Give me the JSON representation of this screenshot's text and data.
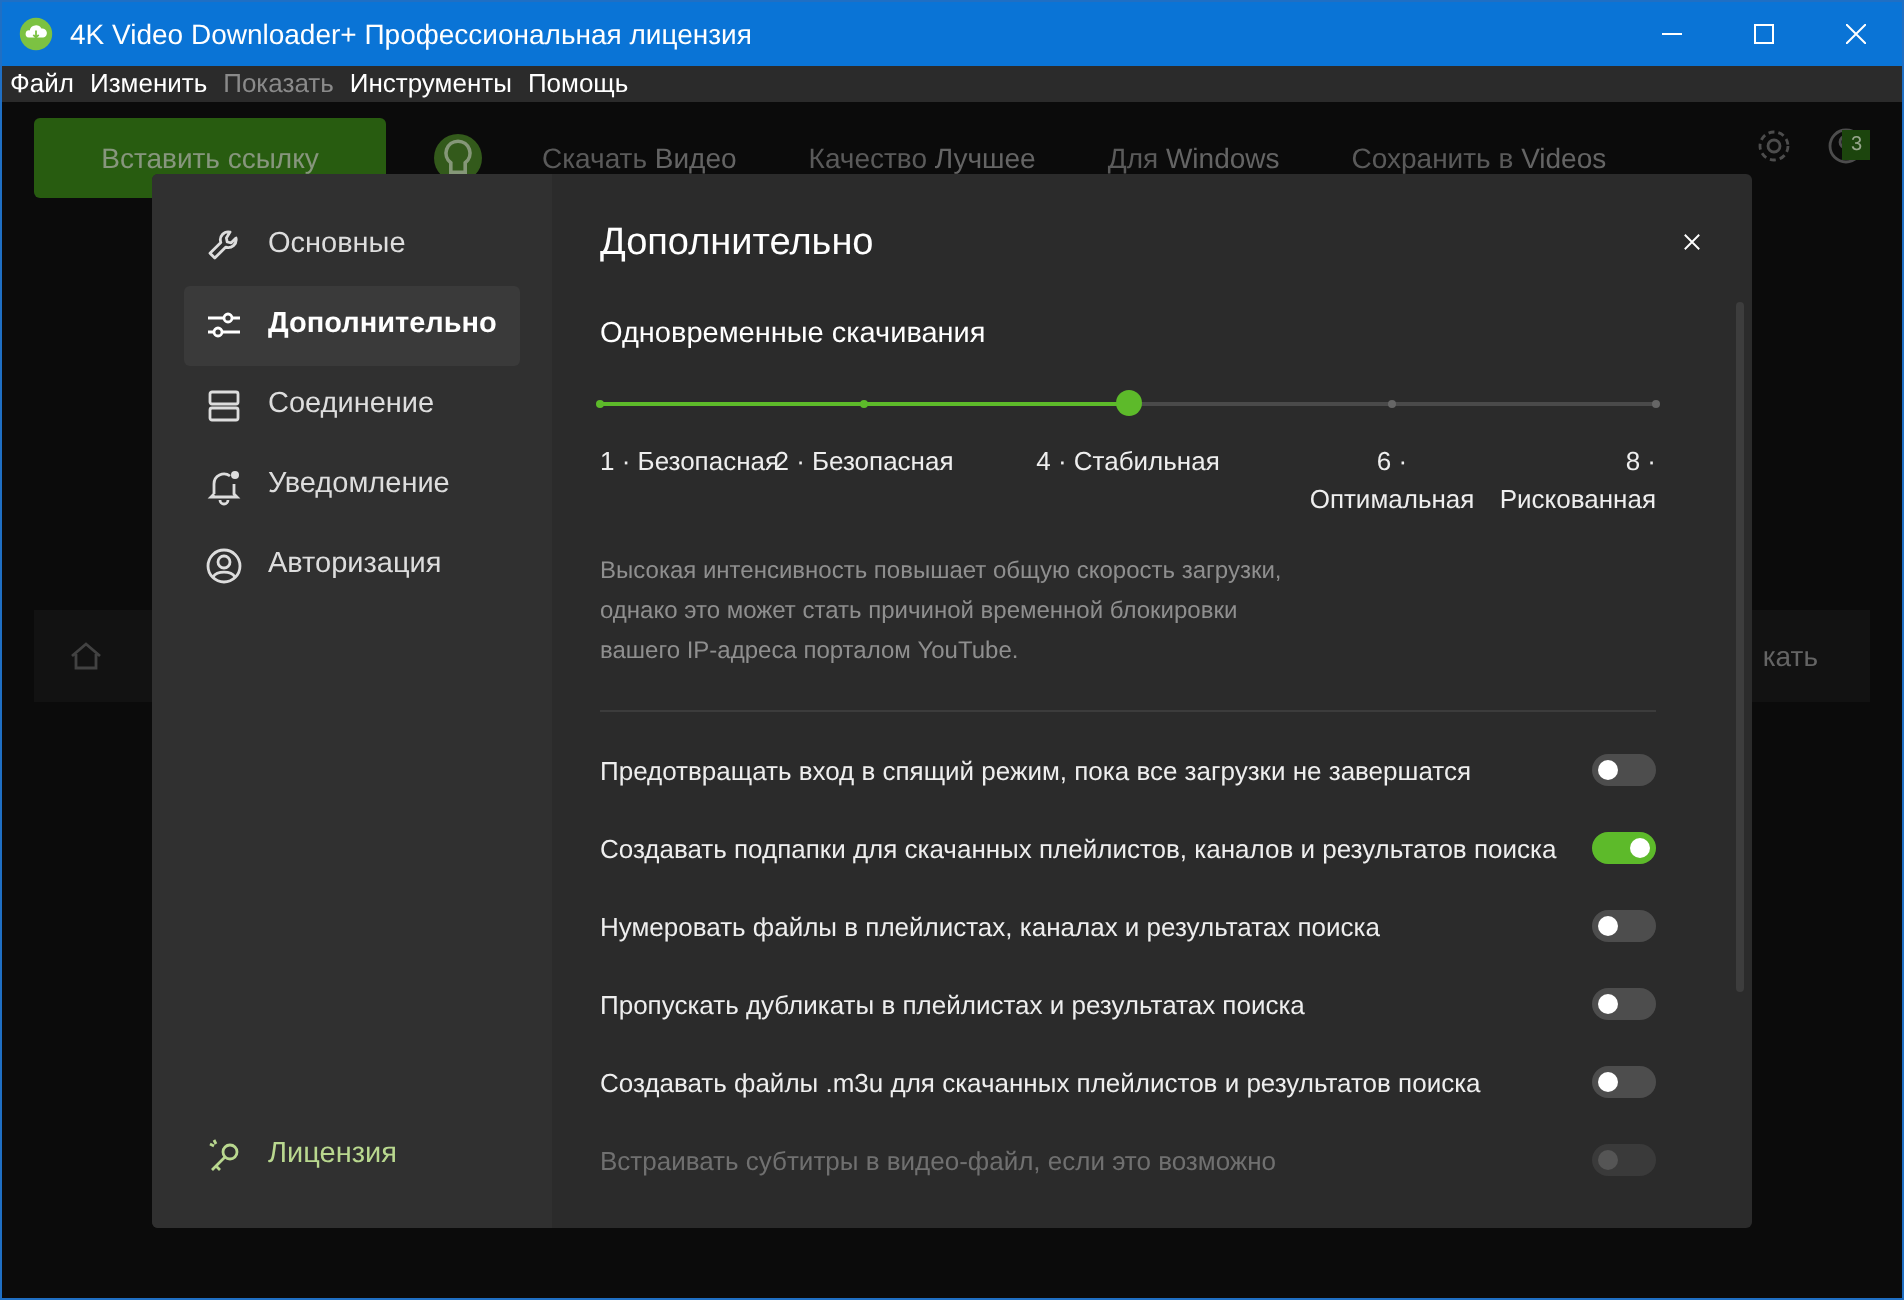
{
  "window": {
    "title": "4K Video Downloader+ Профессиональная лицензия"
  },
  "menu": [
    {
      "label": "Файл",
      "disabled": false
    },
    {
      "label": "Изменить",
      "disabled": false
    },
    {
      "label": "Показать",
      "disabled": true
    },
    {
      "label": "Инструменты",
      "disabled": false
    },
    {
      "label": "Помощь",
      "disabled": false
    }
  ],
  "toolbar": {
    "paste_button": "Вставить ссылку",
    "dropdowns": [
      {
        "label": "Скачать",
        "value": "Видео"
      },
      {
        "label": "Качество",
        "value": "Лучшее"
      },
      {
        "label": "Для",
        "value": "Windows"
      },
      {
        "label": "Сохранить в",
        "value": "Videos"
      }
    ],
    "badge": "3"
  },
  "background_panel": {
    "text": "кать"
  },
  "dialog": {
    "sidebar": {
      "items": [
        {
          "label": "Основные",
          "selected": false
        },
        {
          "label": "Дополнительно",
          "selected": true
        },
        {
          "label": "Соединение",
          "selected": false
        },
        {
          "label": "Уведомление",
          "selected": false
        },
        {
          "label": "Авторизация",
          "selected": false
        }
      ],
      "footer": "Лицензия"
    },
    "title": "Дополнительно",
    "slider": {
      "label": "Одновременные скачивания",
      "level": 0.5,
      "ticks": [
        {
          "number": "1 ·",
          "name": "Безопасная"
        },
        {
          "number": "2 ·",
          "name": "Безопасная"
        },
        {
          "number": "4 ·",
          "name": "Стабильная"
        },
        {
          "number": "6 ·",
          "name": "Оптимальная"
        },
        {
          "number": "8 ·",
          "name": "Рискованная"
        }
      ]
    },
    "hint": "Высокая интенсивность повышает общую скорость загрузки, однако это может стать причиной временной блокировки вашего IP-адреса порталом YouTube.",
    "options": [
      {
        "label": "Предотвращать вход в спящий режим, пока все загрузки не завершатся",
        "on": false,
        "disabled": false
      },
      {
        "label": "Создавать подпапки для скачанных плейлистов, каналов и результатов поиска",
        "on": true,
        "disabled": false
      },
      {
        "label": "Нумеровать файлы в плейлистах, каналах и результатах поиска",
        "on": false,
        "disabled": false
      },
      {
        "label": "Пропускать дубликаты в плейлистах и результатах поиска",
        "on": false,
        "disabled": false
      },
      {
        "label": "Создавать файлы .m3u для скачанных плейлистов и результатов поиска",
        "on": false,
        "disabled": false
      },
      {
        "label": "Встраивать субтитры в видео-файл, если это возможно",
        "on": false,
        "disabled": true
      }
    ]
  }
}
